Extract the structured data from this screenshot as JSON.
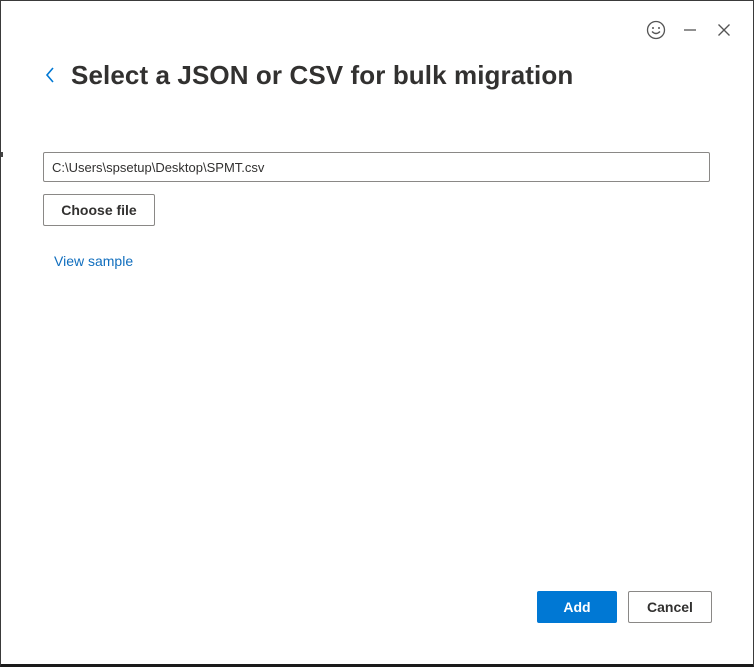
{
  "header": {
    "title": "Select a JSON or CSV for bulk migration",
    "back_icon": "chevron-left-icon"
  },
  "window_controls": {
    "feedback_icon": "smiley-icon",
    "minimize_icon": "minimize-icon",
    "close_icon": "close-icon"
  },
  "file_picker": {
    "path_value": "C:\\Users\\spsetup\\Desktop\\SPMT.csv",
    "choose_label": "Choose file",
    "view_sample_label": "View sample"
  },
  "footer": {
    "add_label": "Add",
    "cancel_label": "Cancel"
  },
  "colors": {
    "accent": "#0078d4",
    "link": "#106ebe",
    "title_text": "#323130"
  }
}
